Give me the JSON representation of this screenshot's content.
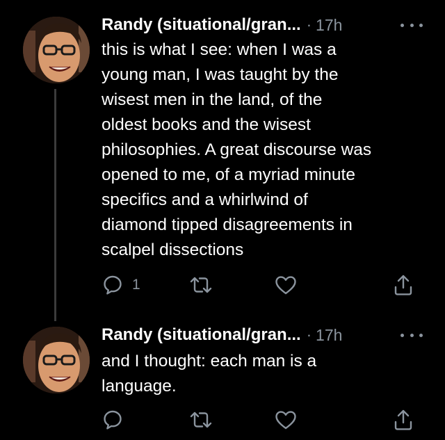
{
  "theme": {
    "background": "#000000",
    "text": "#ffffff",
    "muted": "#8b949e",
    "thread_line": "#3b3b3b"
  },
  "tweets": [
    {
      "display_name": "Randy (situational/gran...",
      "separator": "·",
      "time": "17h",
      "lines": [
        "this is what I see: when I was a",
        "young man, I was taught by the",
        "wisest men in the land, of the",
        "oldest books and the wisest",
        "philosophies. A great discourse was",
        "opened to me, of a myriad minute",
        "specifics and a whirlwind of",
        "diamond tipped disagreements in",
        "scalpel dissections"
      ],
      "reply_count": "1",
      "icons": [
        "reply-icon",
        "retweet-icon",
        "like-icon",
        "share-icon"
      ]
    },
    {
      "display_name": "Randy (situational/gran...",
      "separator": "·",
      "time": "17h",
      "lines": [
        "and I thought: each man is a",
        "language."
      ],
      "icons": [
        "reply-icon",
        "retweet-icon",
        "like-icon",
        "share-icon"
      ]
    }
  ]
}
